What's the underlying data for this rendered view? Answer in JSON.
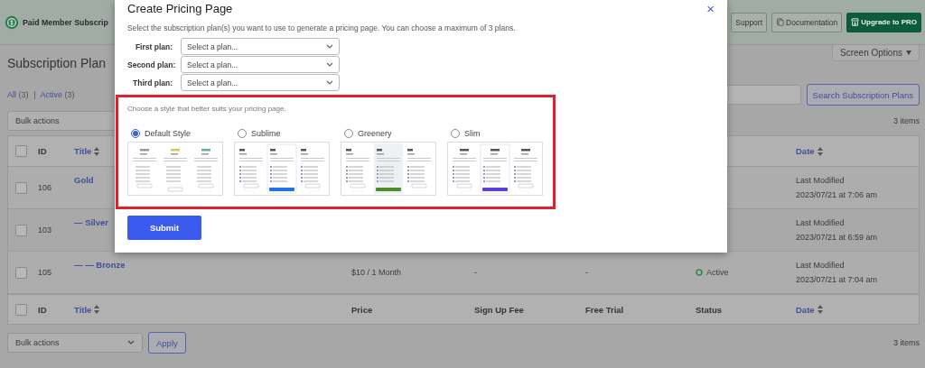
{
  "header": {
    "brand": "Paid Member Subscrip",
    "buttons": [
      {
        "label": "Support",
        "kind": "outline"
      },
      {
        "label": "Documentation",
        "kind": "outline"
      },
      {
        "label": "Upgrade to PRO",
        "kind": "primary"
      }
    ]
  },
  "screen_options": "Screen Options",
  "page_title": "Subscription Plan",
  "filters": [
    {
      "label": "All",
      "count": "(3)"
    },
    {
      "label": "Active",
      "count": "(3)"
    }
  ],
  "search_button": "Search Subscription Plans",
  "top_actions": {
    "bulk": "Bulk actions",
    "count": "3 items"
  },
  "table": {
    "header": {
      "checkbox": {
        "checked": false
      },
      "id": {
        "label": "ID",
        "sortable": false
      },
      "title": {
        "label": "Title",
        "sortable": true
      },
      "date": {
        "label": "Date",
        "sortable": true
      }
    },
    "footer": {
      "checkbox": {
        "checked": false
      },
      "id": {
        "label": "ID",
        "sortable": false
      },
      "title": {
        "label": "Title",
        "sortable": true
      },
      "price": {
        "label": "Price",
        "sortable": false
      },
      "signup_fee": {
        "label": "Sign Up Fee",
        "sortable": false
      },
      "free_trial": {
        "label": "Free Trial",
        "sortable": false
      },
      "status": {
        "label": "Status",
        "sortable": false
      },
      "date": {
        "label": "Date",
        "sortable": true
      }
    },
    "rows": [
      {
        "checked": false,
        "id": "106",
        "title": "Gold",
        "date_label": "Last Modified",
        "date": "2023/07/21 at 7:06 am"
      },
      {
        "checked": false,
        "id": "103",
        "title": "— Silver",
        "date_label": "Last Modified",
        "date": "2023/07/21 at 6:59 am"
      },
      {
        "checked": false,
        "id": "105",
        "title": "— — Bronze",
        "price": "$10 / 1 Month",
        "signup_fee": "-",
        "free_trial": "-",
        "status": "Active",
        "date_label": "Last Modified",
        "date": "2023/07/21 at 7:04 am"
      }
    ]
  },
  "bottom_actions": {
    "bulk": "Bulk actions",
    "apply": "Apply",
    "count": "3 items"
  },
  "modal": {
    "title": "Create Pricing Page",
    "close": "×",
    "description": "Select the subscription plan(s) you want to use to generate a pricing page. You can choose a maximum of 3 plans.",
    "plans": [
      {
        "label": "First plan:",
        "placeholder": "Select a plan..."
      },
      {
        "label": "Second plan:",
        "placeholder": "Select a plan..."
      },
      {
        "label": "Third plan:",
        "placeholder": "Select a plan..."
      }
    ],
    "style_prompt": "Choose a style that better suits your pricing page.",
    "styles": [
      {
        "label": "Default Style",
        "kind": "default",
        "selected": true
      },
      {
        "label": "Sublime",
        "kind": "sublime",
        "selected": false
      },
      {
        "label": "Greenery",
        "kind": "greenery",
        "selected": false
      },
      {
        "label": "Slim",
        "kind": "slim",
        "selected": false
      }
    ],
    "submit": "Submit"
  }
}
